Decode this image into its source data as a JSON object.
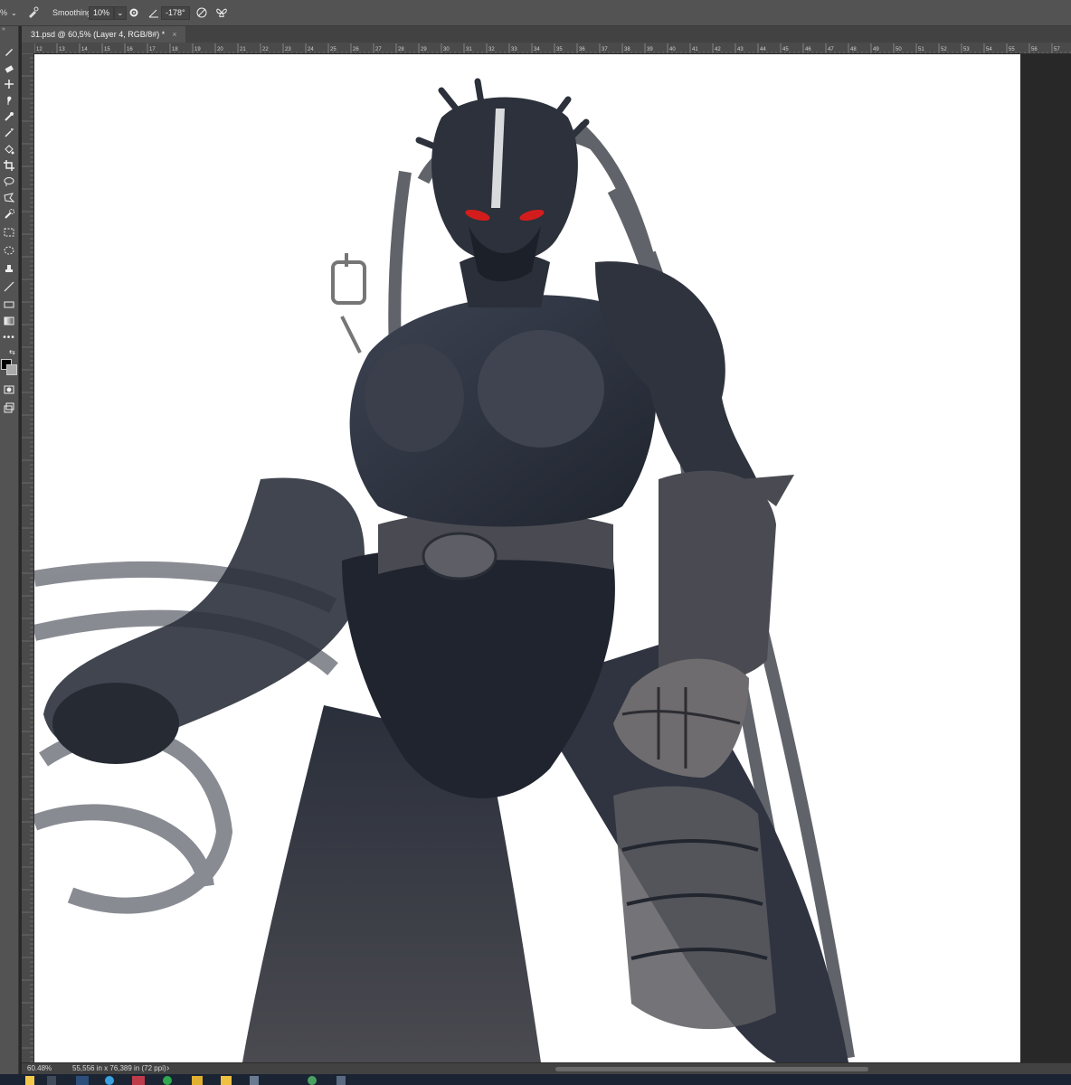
{
  "options_bar": {
    "opacity_partial": "%",
    "smoothing_label": "Smoothing:",
    "smoothing_value": "10%",
    "angle_value": "-178°"
  },
  "document_tab": {
    "title": "31.psd @ 60,5% (Layer 4, RGB/8#) *",
    "close": "×"
  },
  "ruler_top_ticks": [
    "12",
    "13",
    "14",
    "15",
    "16",
    "17",
    "18",
    "19",
    "20",
    "21",
    "22",
    "23",
    "24",
    "25",
    "26",
    "27",
    "28",
    "29",
    "30",
    "31",
    "32",
    "33",
    "34",
    "35",
    "36",
    "37",
    "38",
    "39",
    "40",
    "41",
    "42",
    "43",
    "44",
    "45",
    "46",
    "47",
    "48",
    "49",
    "50",
    "51",
    "52",
    "53",
    "54",
    "55",
    "56",
    "57"
  ],
  "status_bar": {
    "zoom": "60.48%",
    "doc_info": "55,556 in x 76,389 in (72 ppi)",
    "arrow": "›"
  },
  "tools": [
    "brush-tool-icon",
    "eraser-tool-icon",
    "move-tool-icon",
    "smudge-tool-icon",
    "mixer-brush-icon",
    "magic-wand-icon",
    "paint-bucket-icon",
    "crop-tool-icon",
    "lasso-tool-icon",
    "polygonal-lasso-icon",
    "quick-select-icon",
    "rect-marquee-icon",
    "ellipse-marquee-icon",
    "clone-stamp-icon",
    "line-tool-icon",
    "rectangle-tool-icon",
    "gradient-tool-icon",
    "more-tools-icon"
  ],
  "colors": {
    "ui_panel": "#535353",
    "ui_dark": "#282828",
    "canvas": "#ffffff",
    "armor_dark": "#1e232d",
    "armor_mid": "#3c4150",
    "armor_light": "#7b7c82",
    "eye_red": "#d31d1d"
  }
}
